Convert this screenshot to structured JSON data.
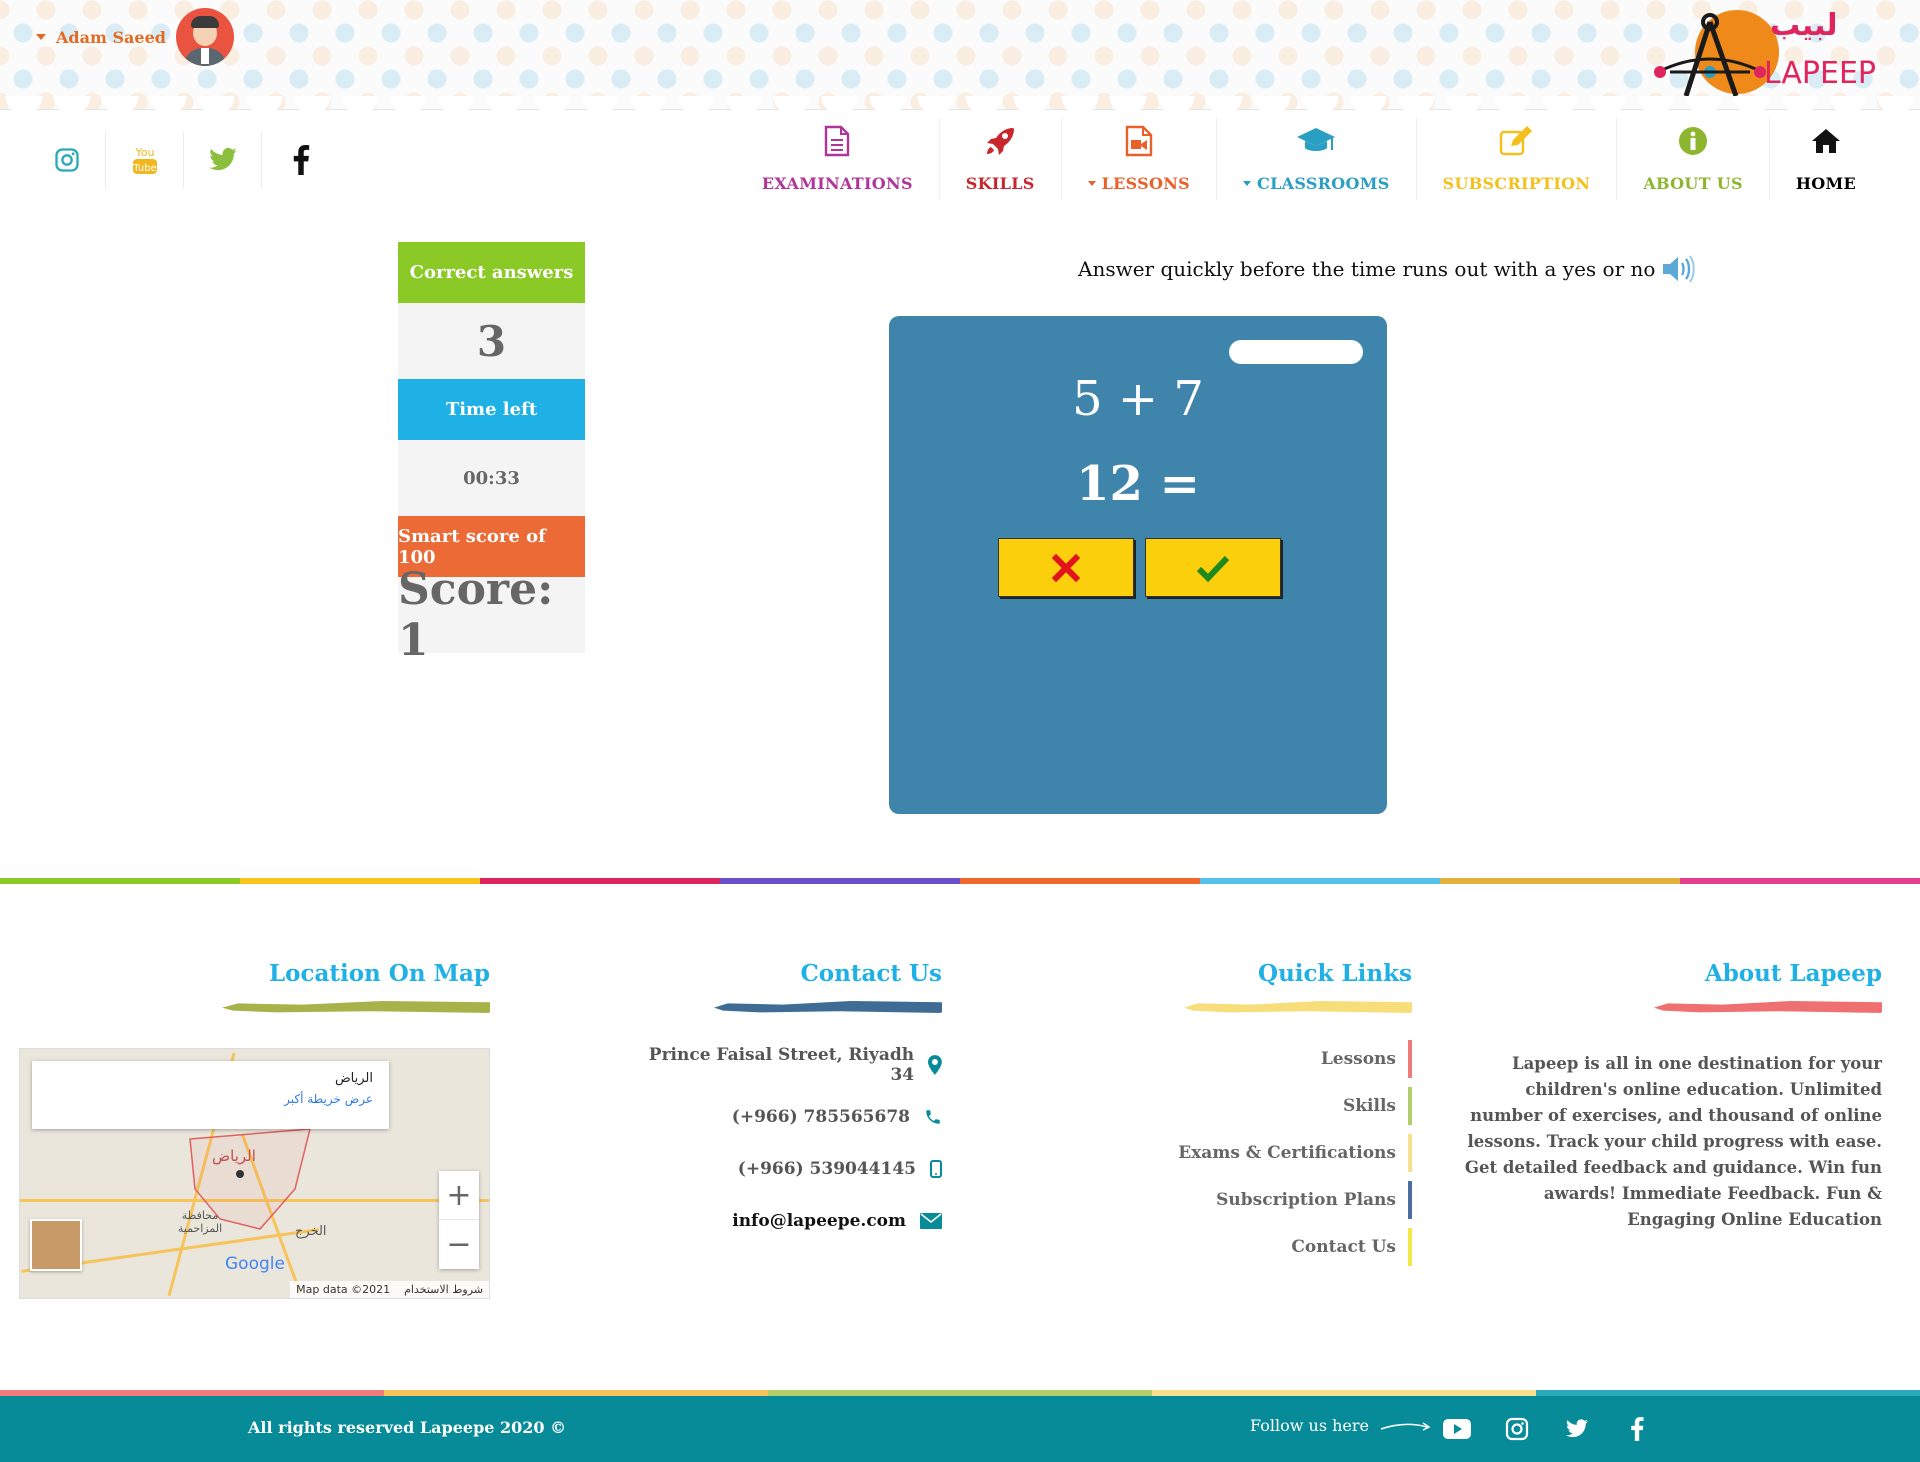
{
  "user": {
    "name": "Adam Saeed"
  },
  "brand": {
    "arabic_name": "لبيب",
    "latin_name": "LAPEEP"
  },
  "nav": [
    {
      "label": "EXAMINATIONS",
      "color": "#b0359a",
      "icon": "document-icon",
      "dropdown": false
    },
    {
      "label": "SKILLS",
      "color": "#c8262c",
      "icon": "rocket-icon",
      "dropdown": false
    },
    {
      "label": "LESSONS",
      "color": "#e8602a",
      "icon": "video-file-icon",
      "dropdown": true
    },
    {
      "label": "CLASSROOMS",
      "color": "#2a9fc4",
      "icon": "graduation-cap-icon",
      "dropdown": true
    },
    {
      "label": "SUBSCRIPTION",
      "color": "#f4c01c",
      "icon": "edit-icon",
      "dropdown": false
    },
    {
      "label": "ABOUT US",
      "color": "#8db630",
      "icon": "info-icon",
      "dropdown": false
    },
    {
      "label": "HOME",
      "color": "#000000",
      "icon": "home-icon",
      "dropdown": false
    }
  ],
  "social_top": [
    {
      "icon": "instagram-icon",
      "color": "#2aaab8"
    },
    {
      "icon": "youtube-icon",
      "color": "#f2b71e"
    },
    {
      "icon": "twitter-icon",
      "color": "#8dbf3f"
    },
    {
      "icon": "facebook-icon",
      "color": "#111111"
    }
  ],
  "score_panel": {
    "correct_label": "Correct answers",
    "correct_value": "3",
    "time_label": "Time left",
    "time_value": "00:33",
    "smart_label": "Smart score of 100",
    "score_value": "Score: 1",
    "colors": {
      "correct": "#8ac926",
      "time": "#1fb1e6",
      "smart": "#ec6a36"
    }
  },
  "game": {
    "instruction": "Answer quickly before the time runs out with a yes or no",
    "question": "5 + 7",
    "proposed_answer": "12 =",
    "no_icon": "x-mark-icon",
    "yes_icon": "check-mark-icon",
    "card_color": "#3f85ab",
    "button_color": "#fccf0d"
  },
  "footer": {
    "location_title": "Location On Map",
    "contact_title": "Contact Us",
    "quick_links_title": "Quick Links",
    "about_title": "About Lapeep",
    "map": {
      "popup_city": "الرياض",
      "popup_link": "عرض خريطة أكبر",
      "label_city": "الرياض",
      "label_region": "محافظة المزاحمية",
      "label_town": "الخرج",
      "google": "Google",
      "map_data": "Map data ©2021",
      "terms": "شروط الاستخدام",
      "zoom_in": "+",
      "zoom_out": "−"
    },
    "contact": [
      {
        "text": "Prince Faisal Street, Riyadh 34",
        "icon": "location-pin-icon"
      },
      {
        "text": "(+966) 785565678",
        "icon": "phone-icon"
      },
      {
        "text": "(+966) 539044145",
        "icon": "mobile-icon"
      },
      {
        "text": "info@lapeepe.com",
        "icon": "envelope-icon"
      }
    ],
    "quick_links": [
      {
        "label": "Lessons",
        "color": "#ef7b7b"
      },
      {
        "label": "Skills",
        "color": "#b3cf6c"
      },
      {
        "label": "Exams & Certifications",
        "color": "#f8e08e"
      },
      {
        "label": "Subscription Plans",
        "color": "#4a6fa0"
      },
      {
        "label": "Contact Us",
        "color": "#f3e84a"
      }
    ],
    "about_text": "Lapeep is all in one destination for your children's online education. Unlimited number of exercises, and thousand of online lessons. Track your child progress with ease. Get detailed feedback and guidance. Win fun awards! Immediate Feedback. Fun & Engaging Online Education",
    "copyright": "All rights reserved Lapeepe 2020 ©",
    "follow_label": "Follow us here",
    "follow_icons": [
      "youtube-icon",
      "instagram-icon",
      "twitter-icon",
      "facebook-icon"
    ],
    "bar_color": "#078b98"
  }
}
